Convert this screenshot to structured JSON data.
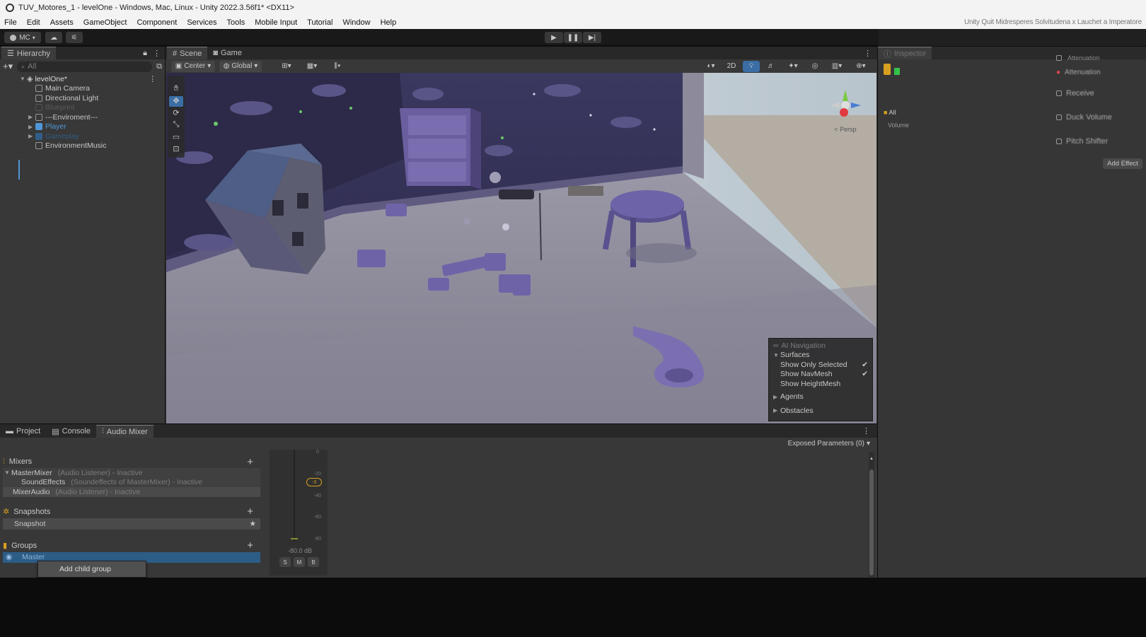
{
  "window": {
    "title": "TUV_Motores_1 - levelOne - Windows, Mac, Linux - Unity 2022.3.56f1* <DX11>"
  },
  "menu": {
    "items": [
      "File",
      "Edit",
      "Assets",
      "GameObject",
      "Component",
      "Services",
      "Tools",
      "Mobile Input",
      "Tutorial",
      "Window",
      "Help"
    ],
    "right_text": "Unity Quit Midresperes Solvitudena x Lauchet a Imperatore"
  },
  "toolbar": {
    "account_label": "MC",
    "play_icon": "play-icon",
    "pause_icon": "pause-icon",
    "step_icon": "step-icon"
  },
  "hierarchy": {
    "tab_label": "Hierarchy",
    "search_placeholder": "All",
    "scene_name": "levelOne*",
    "items": [
      {
        "label": "Main Camera",
        "state": "normal"
      },
      {
        "label": "Directional Light",
        "state": "normal"
      },
      {
        "label": "Blueprint",
        "state": "dim"
      },
      {
        "label": "---Enviroment---",
        "state": "normal"
      },
      {
        "label": "Player",
        "state": "blue"
      },
      {
        "label": "Gameplay",
        "state": "bluedim"
      },
      {
        "label": "EnvironmentMusic",
        "state": "normal"
      }
    ]
  },
  "scene_tabs": {
    "scene": "Scene",
    "game": "Game",
    "pivot": "Center",
    "space": "Global",
    "mode_2d": "2D",
    "persp_label": "< Persp"
  },
  "ai_navigation": {
    "title": "AI Navigation",
    "surfaces": "Surfaces",
    "show_only_selected": "Show Only Selected",
    "show_navmesh": "Show NavMesh",
    "show_heightmesh": "Show HeightMesh",
    "show_only_selected_checked": true,
    "show_navmesh_checked": true,
    "show_heightmesh_checked": false,
    "agents": "Agents",
    "obstacles": "Obstacles"
  },
  "bottom_tabs": {
    "project": "Project",
    "console": "Console",
    "audio_mixer": "Audio Mixer",
    "exposed_params": "Exposed Parameters (0)"
  },
  "mixers": {
    "title": "Mixers",
    "items": [
      {
        "name": "MasterMixer",
        "detail": "(Audio Listener) - Inactive",
        "indent": 0
      },
      {
        "name": "SoundEffects",
        "detail": "(Soundeffects of MasterMixer) - Inactive",
        "indent": 1
      },
      {
        "name": "MixerAudio",
        "detail": "(Audio Listener) - Inactive",
        "indent": 0
      }
    ]
  },
  "snapshots": {
    "title": "Snapshots",
    "item": "Snapshot"
  },
  "groups": {
    "title": "Groups",
    "item": "Master",
    "context_menu_item": "Add child group"
  },
  "channel_strip": {
    "db_value": "-80.0 dB",
    "meter_value": "-3",
    "scale": [
      "0",
      "-20",
      "-40",
      "-60",
      "-80"
    ],
    "buttons": [
      "S",
      "M",
      "B"
    ]
  },
  "inspector": {
    "tab_label": "Inspector",
    "attenuation_label": "Attenuation",
    "effects": [
      "Attenuation",
      "Receive",
      "Duck Volume",
      "Pitch Shifter"
    ],
    "add_effect": "Add Effect",
    "all_label": "All",
    "volume_label": "Volume"
  },
  "colors": {
    "accent_blue": "#2c5d87",
    "panel": "#383838",
    "selection": "#2c5d87",
    "wall_sky": "#3d3a5f",
    "floor": "#8b8898",
    "prop_purple": "#6b5f9c"
  }
}
